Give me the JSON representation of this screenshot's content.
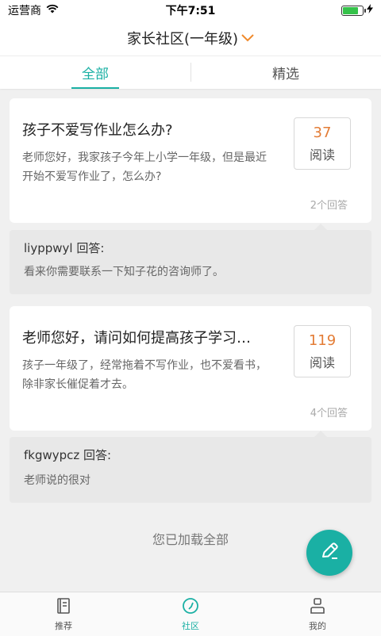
{
  "status": {
    "carrier": "运营商",
    "time": "下午7:51",
    "battery_level": 0.8,
    "battery_color": "#35c24a"
  },
  "header": {
    "title": "家长社区(一年级)",
    "dropdown_icon": "chevron-down-icon",
    "accent_color": "#f08a2c"
  },
  "tabs": [
    {
      "label": "全部",
      "active": true
    },
    {
      "label": "精选",
      "active": false
    }
  ],
  "posts": [
    {
      "title": "孩子不爱写作业怎么办?",
      "body": "老师您好，我家孩子今年上小学一年级，但是最近开始不爱写作业了，怎么办?",
      "read_count": "37",
      "read_label": "阅读",
      "answers": "2个回答",
      "reply_author": "liyppwyl 回答:",
      "reply_text": "看来你需要联系一下知子花的咨询师了。"
    },
    {
      "title": "老师您好，请问如何提高孩子学习…",
      "body": "孩子一年级了，经常拖着不写作业，也不爱看书，除非家长催促着才去。",
      "read_count": "119",
      "read_label": "阅读",
      "answers": "4个回答",
      "reply_author": "fkgwypcz 回答:",
      "reply_text": "老师说的很对"
    }
  ],
  "footer_text": "您已加载全部",
  "fab_icon": "pencil-icon",
  "bottom_nav": [
    {
      "label": "推荐",
      "icon": "book-icon",
      "active": false
    },
    {
      "label": "社区",
      "icon": "compass-icon",
      "active": true
    },
    {
      "label": "我的",
      "icon": "person-icon",
      "active": false
    }
  ],
  "colors": {
    "primary": "#1ab0a4",
    "read_count": "#e37c35"
  }
}
